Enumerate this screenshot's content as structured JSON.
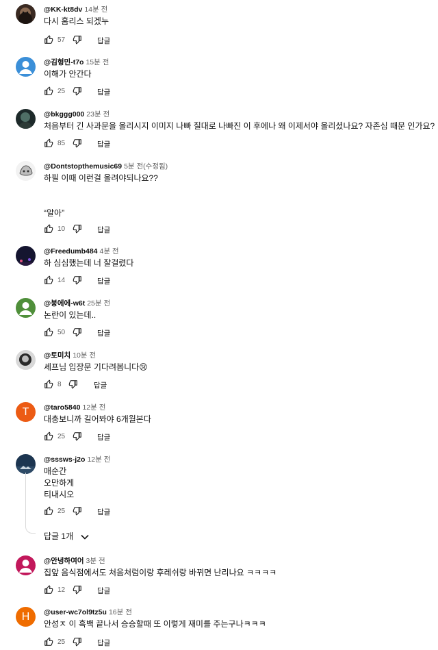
{
  "comments": [
    {
      "author": "@KK-kt8dv",
      "time": "14분 전",
      "text": "다시 홈리스 되겠누",
      "likes": "57",
      "reply": "답글"
    },
    {
      "author": "@김형민-t7o",
      "time": "15분 전",
      "text": "이해가 안간다",
      "likes": "25",
      "reply": "답글"
    },
    {
      "author": "@bkggg000",
      "time": "23분 전",
      "text": "처음부터 긴 사과문을 올리시지 이미지 나빠 질대로 나빠진 이 후에나 왜 이제서야 올리셨나요? 자존심 때문 인가요?",
      "likes": "85",
      "reply": "답글"
    },
    {
      "author": "@Dontstopthemusic69",
      "time": "5분 전(수정됨)",
      "text": "하필 이때 이런걸 올려야되나요??\n\n\n“알아”",
      "likes": "10",
      "reply": "답글"
    },
    {
      "author": "@Freedumb484",
      "time": "4분 전",
      "text": "하 심심했는데 너 잘걸렸다",
      "likes": "14",
      "reply": "답글"
    },
    {
      "author": "@붕에에-w6t",
      "time": "25분 전",
      "text": "논란이 있는데..",
      "likes": "50",
      "reply": "답글"
    },
    {
      "author": "@토미치",
      "time": "10분 전",
      "text": "셰프님 입장문 기다려봅니다😢",
      "likes": "8",
      "reply": "답글"
    },
    {
      "author": "@taro5840",
      "time": "12분 전",
      "text": "대충보니까 길어봐야 6개월본다",
      "likes": "25",
      "reply": "답글",
      "avatar_letter": "T"
    },
    {
      "author": "@sssws-j2o",
      "time": "12분 전",
      "text": "매순간\n오만하게\n티내시오",
      "likes": "25",
      "reply": "답글"
    },
    {
      "author": "@안녕하여어",
      "time": "3분 전",
      "text": "집앞 음식점에서도 처음처럼이랑 후레쉬랑 바뀌면 난리나요 ㅋㅋㅋㅋ",
      "likes": "12",
      "reply": "답글"
    },
    {
      "author": "@user-wc7ol9tz5u",
      "time": "16분 전",
      "text": "안성ㅈ 이 흑백 끝나서 승승할때 또 이렇게 재미를 주는구나ㅋㅋㅋ",
      "likes": "25",
      "reply": "답글",
      "avatar_letter": "H"
    }
  ],
  "replies_toggle": "답글 1개",
  "colors": {
    "avatar_blue": "#3b8fd8",
    "avatar_green": "#4f8f3a",
    "avatar_orange": "#ec5b14",
    "avatar_pink": "#c2185b",
    "avatar_orange2": "#ef6c00"
  }
}
